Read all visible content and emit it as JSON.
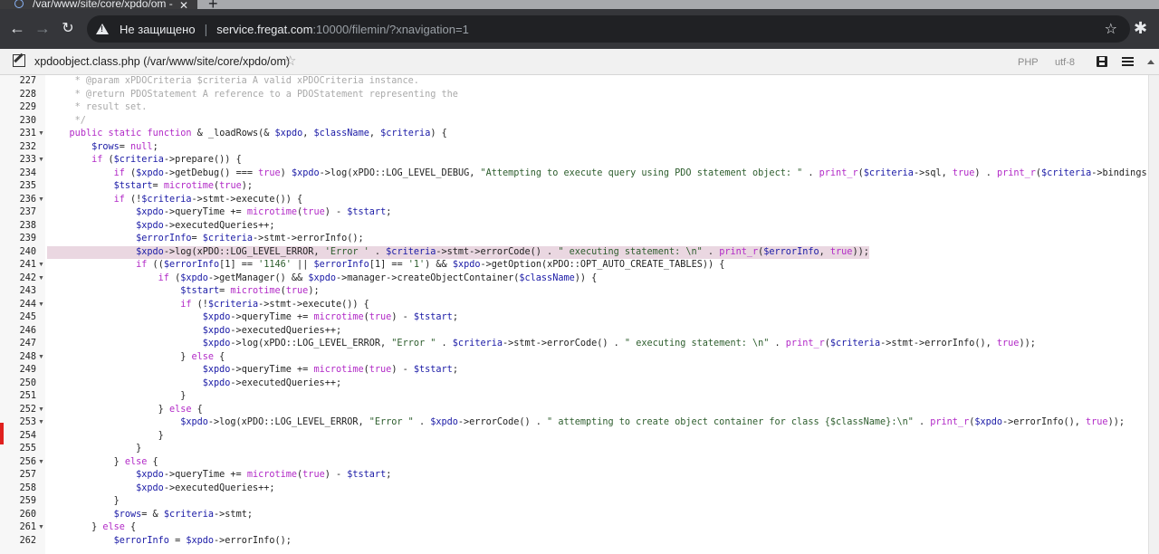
{
  "browser": {
    "tab_title": "/var/www/site/core/xpdo/om - ",
    "security_text": "Не защищено",
    "url_host": "service.fregat.com",
    "url_rest": ":10000/filemin/?xnavigation=1"
  },
  "editor": {
    "file_title": "xpdoobject.class.php (/var/www/site/core/xpdo/om)",
    "mode": "PHP",
    "encoding": "utf-8"
  },
  "code_lines": [
    {
      "n": "227",
      "fold": false,
      "hl": false,
      "text": "     * @param xPDOCriteria $criteria A valid xPDOCriteria instance."
    },
    {
      "n": "228",
      "fold": false,
      "hl": false,
      "text": "     * @return PDOStatement A reference to a PDOStatement representing the"
    },
    {
      "n": "229",
      "fold": false,
      "hl": false,
      "text": "     * result set."
    },
    {
      "n": "230",
      "fold": false,
      "hl": false,
      "text": "     */"
    },
    {
      "n": "231",
      "fold": true,
      "hl": false,
      "text": "    public static function & _loadRows(& $xpdo, $className, $criteria) {"
    },
    {
      "n": "232",
      "fold": false,
      "hl": false,
      "text": "        $rows= null;"
    },
    {
      "n": "233",
      "fold": true,
      "hl": false,
      "text": "        if ($criteria->prepare()) {"
    },
    {
      "n": "234",
      "fold": false,
      "hl": false,
      "text": "            if ($xpdo->getDebug() === true) $xpdo->log(xPDO::LOG_LEVEL_DEBUG, \"Attempting to execute query using PDO statement object: \" . print_r($criteria->sql, true) . print_r($criteria->bindings"
    },
    {
      "n": "235",
      "fold": false,
      "hl": false,
      "text": "            $tstart= microtime(true);"
    },
    {
      "n": "236",
      "fold": true,
      "hl": false,
      "text": "            if (!$criteria->stmt->execute()) {"
    },
    {
      "n": "237",
      "fold": false,
      "hl": false,
      "text": "                $xpdo->queryTime += microtime(true) - $tstart;"
    },
    {
      "n": "238",
      "fold": false,
      "hl": false,
      "text": "                $xpdo->executedQueries++;"
    },
    {
      "n": "239",
      "fold": false,
      "hl": false,
      "text": "                $errorInfo= $criteria->stmt->errorInfo();"
    },
    {
      "n": "240",
      "fold": false,
      "hl": true,
      "text": "                $xpdo->log(xPDO::LOG_LEVEL_ERROR, 'Error ' . $criteria->stmt->errorCode() . \" executing statement: \\n\" . print_r($errorInfo, true));"
    },
    {
      "n": "241",
      "fold": true,
      "hl": false,
      "text": "                if (($errorInfo[1] == '1146' || $errorInfo[1] == '1') && $xpdo->getOption(xPDO::OPT_AUTO_CREATE_TABLES)) {"
    },
    {
      "n": "242",
      "fold": true,
      "hl": false,
      "text": "                    if ($xpdo->getManager() && $xpdo->manager->createObjectContainer($className)) {"
    },
    {
      "n": "243",
      "fold": false,
      "hl": false,
      "text": "                        $tstart= microtime(true);"
    },
    {
      "n": "244",
      "fold": true,
      "hl": false,
      "text": "                        if (!$criteria->stmt->execute()) {"
    },
    {
      "n": "245",
      "fold": false,
      "hl": false,
      "text": "                            $xpdo->queryTime += microtime(true) - $tstart;"
    },
    {
      "n": "246",
      "fold": false,
      "hl": false,
      "text": "                            $xpdo->executedQueries++;"
    },
    {
      "n": "247",
      "fold": false,
      "hl": false,
      "text": "                            $xpdo->log(xPDO::LOG_LEVEL_ERROR, \"Error \" . $criteria->stmt->errorCode() . \" executing statement: \\n\" . print_r($criteria->stmt->errorInfo(), true));"
    },
    {
      "n": "248",
      "fold": true,
      "hl": false,
      "text": "                        } else {"
    },
    {
      "n": "249",
      "fold": false,
      "hl": false,
      "text": "                            $xpdo->queryTime += microtime(true) - $tstart;"
    },
    {
      "n": "250",
      "fold": false,
      "hl": false,
      "text": "                            $xpdo->executedQueries++;"
    },
    {
      "n": "251",
      "fold": false,
      "hl": false,
      "text": "                        }"
    },
    {
      "n": "252",
      "fold": true,
      "hl": false,
      "text": "                    } else {"
    },
    {
      "n": "253",
      "fold": true,
      "hl": false,
      "text": "                        $xpdo->log(xPDO::LOG_LEVEL_ERROR, \"Error \" . $xpdo->errorCode() . \" attempting to create object container for class {$className}:\\n\" . print_r($xpdo->errorInfo(), true));"
    },
    {
      "n": "254",
      "fold": false,
      "hl": false,
      "text": "                    }"
    },
    {
      "n": "255",
      "fold": false,
      "hl": false,
      "text": "                }"
    },
    {
      "n": "256",
      "fold": true,
      "hl": false,
      "text": "            } else {"
    },
    {
      "n": "257",
      "fold": false,
      "hl": false,
      "text": "                $xpdo->queryTime += microtime(true) - $tstart;"
    },
    {
      "n": "258",
      "fold": false,
      "hl": false,
      "text": "                $xpdo->executedQueries++;"
    },
    {
      "n": "259",
      "fold": false,
      "hl": false,
      "text": "            }"
    },
    {
      "n": "260",
      "fold": false,
      "hl": false,
      "text": "            $rows= & $criteria->stmt;"
    },
    {
      "n": "261",
      "fold": true,
      "hl": false,
      "text": "        } else {"
    },
    {
      "n": "262",
      "fold": false,
      "hl": false,
      "text": "            $errorInfo = $xpdo->errorInfo();"
    }
  ],
  "colors": {
    "comment": "#a9a9a9",
    "keyword": "#b22ac7",
    "variable": "#1a1aa6",
    "string": "#2d5d2d",
    "highlight": "#ead7e1"
  }
}
